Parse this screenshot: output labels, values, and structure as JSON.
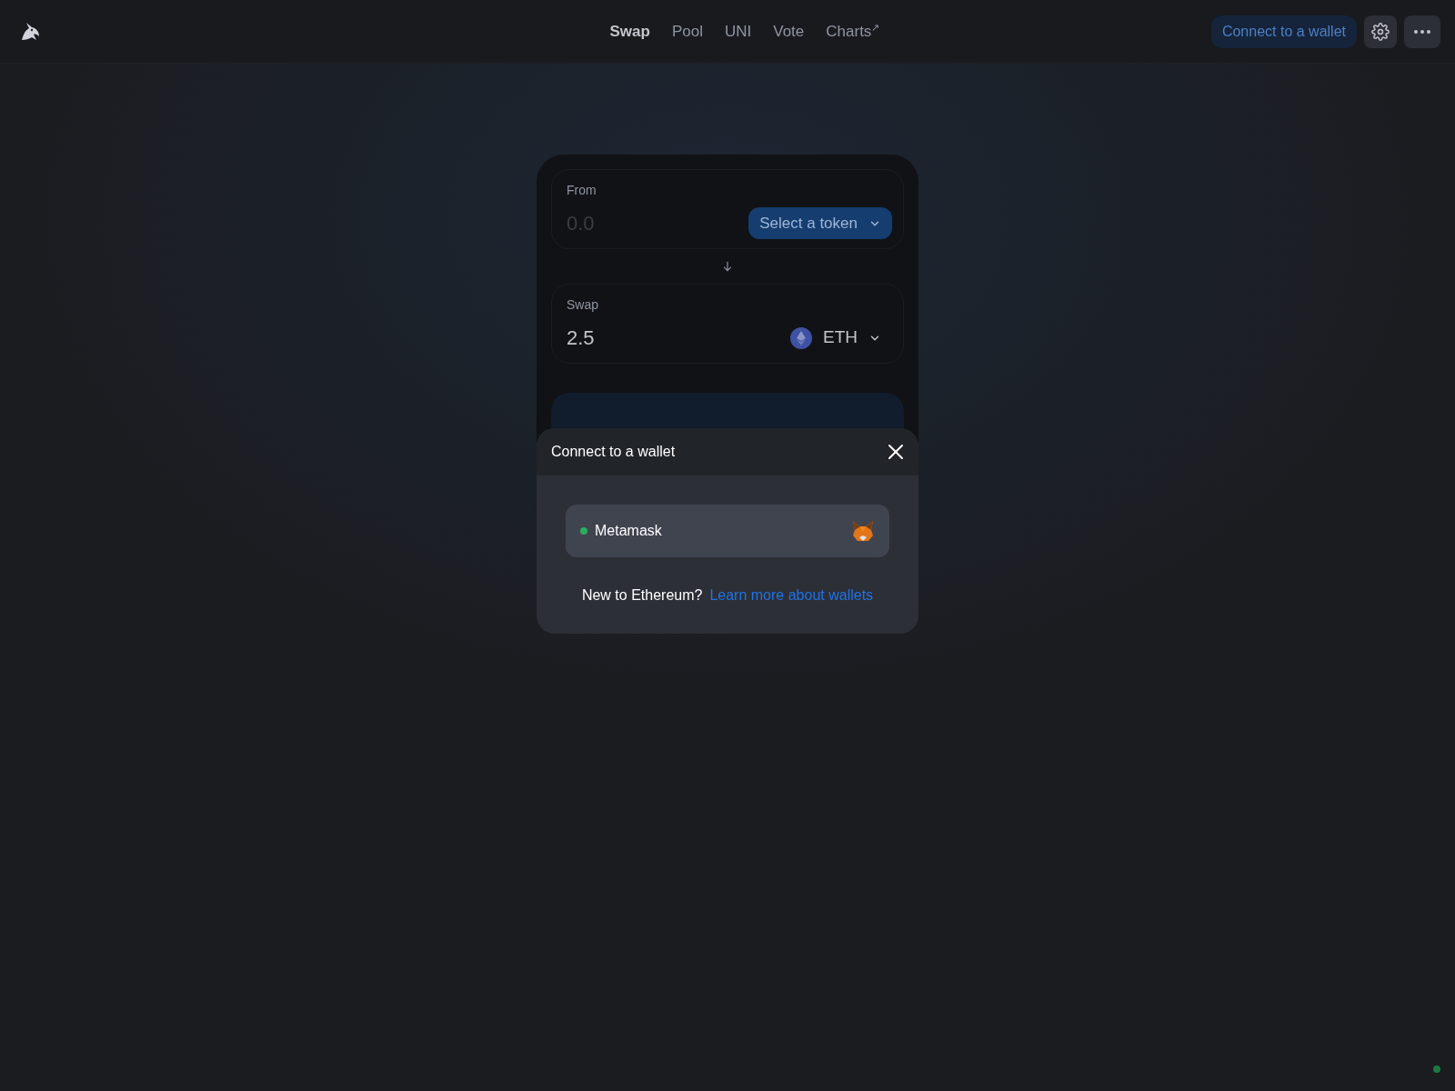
{
  "nav": [
    {
      "label": "Swap",
      "selected": true
    },
    {
      "label": "Pool",
      "selected": false
    },
    {
      "label": "UNI",
      "selected": false
    },
    {
      "label": "Vote",
      "selected": false
    },
    {
      "label": "Charts",
      "selected": false,
      "external_mark": "↗"
    }
  ],
  "header": {
    "connect_button": "Connect to a wallet"
  },
  "from_panel": {
    "label": "From",
    "placeholder": "0.0",
    "token_button": "Select a token"
  },
  "to_panel": {
    "label": "Swap",
    "value": "2.5",
    "token": "ETH"
  },
  "modal": {
    "title": "Connect to a wallet",
    "wallets": [
      {
        "name": "Metamask",
        "color": "#27ae60"
      }
    ],
    "prompt": "New to Ethereum?",
    "link": "Learn more about wallets"
  },
  "status": {
    "color": "#1a7a3e"
  }
}
